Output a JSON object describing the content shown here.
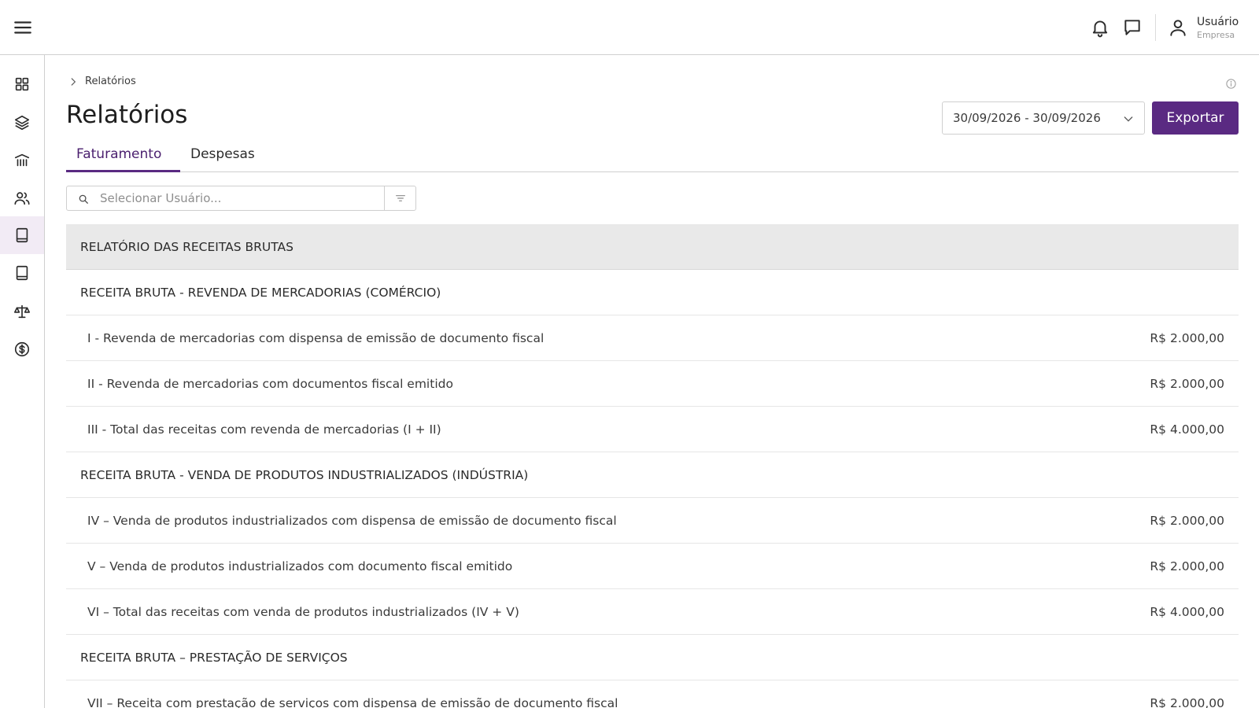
{
  "header": {
    "user_name": "Usuário",
    "user_company": "Empresa",
    "icons": [
      "menu-icon",
      "bell-icon",
      "chat-icon",
      "user-icon"
    ]
  },
  "sidebar": {
    "items": [
      {
        "icon": "dashboard-icon"
      },
      {
        "icon": "layers-icon"
      },
      {
        "icon": "bank-icon"
      },
      {
        "icon": "users-icon"
      },
      {
        "icon": "book-icon",
        "active": true
      },
      {
        "icon": "book-alt-icon"
      },
      {
        "icon": "scale-icon"
      },
      {
        "icon": "dollar-icon"
      }
    ]
  },
  "breadcrumb": {
    "current": "Relatórios"
  },
  "page": {
    "title": "Relatórios"
  },
  "date_range": {
    "value": "30/09/2026 - 30/09/2026"
  },
  "export": {
    "label": "Exportar"
  },
  "tabs": [
    {
      "label": "Faturamento",
      "active": true
    },
    {
      "label": "Despesas",
      "active": false
    }
  ],
  "search": {
    "placeholder": "Selecionar Usuário..."
  },
  "report": {
    "title": "RELATÓRIO DAS RECEITAS BRUTAS",
    "rows": [
      {
        "type": "section",
        "label": "RECEITA BRUTA - REVENDA DE MERCADORIAS (COMÉRCIO)",
        "value": ""
      },
      {
        "type": "item",
        "label": "I - Revenda de mercadorias com dispensa de emissão de documento fiscal",
        "value": "R$ 2.000,00"
      },
      {
        "type": "item",
        "label": "II - Revenda de mercadorias com documentos fiscal emitido",
        "value": "R$ 2.000,00"
      },
      {
        "type": "item",
        "label": "III - Total das receitas com revenda de mercadorias (I + II)",
        "value": "R$ 4.000,00"
      },
      {
        "type": "section",
        "label": "RECEITA BRUTA - VENDA DE PRODUTOS INDUSTRIALIZADOS (INDÚSTRIA)",
        "value": ""
      },
      {
        "type": "item",
        "label": "IV – Venda de produtos industrializados com dispensa de emissão de documento fiscal",
        "value": "R$ 2.000,00"
      },
      {
        "type": "item",
        "label": "V – Venda de produtos industrializados com documento fiscal emitido",
        "value": "R$ 2.000,00"
      },
      {
        "type": "item",
        "label": "VI – Total das receitas com venda de produtos industrializados (IV + V)",
        "value": "R$ 4.000,00"
      },
      {
        "type": "section",
        "label": "RECEITA BRUTA – PRESTAÇÃO DE SERVIÇOS",
        "value": ""
      },
      {
        "type": "item",
        "label": "VII – Receita com prestação de serviços com dispensa de emissão de documento fiscal",
        "value": "R$ 2.000,00"
      }
    ]
  },
  "colors": {
    "accent": "#5a2a82",
    "header_bg": "#e9e9e9",
    "active_sidebar_bg": "#f2ebf5"
  }
}
